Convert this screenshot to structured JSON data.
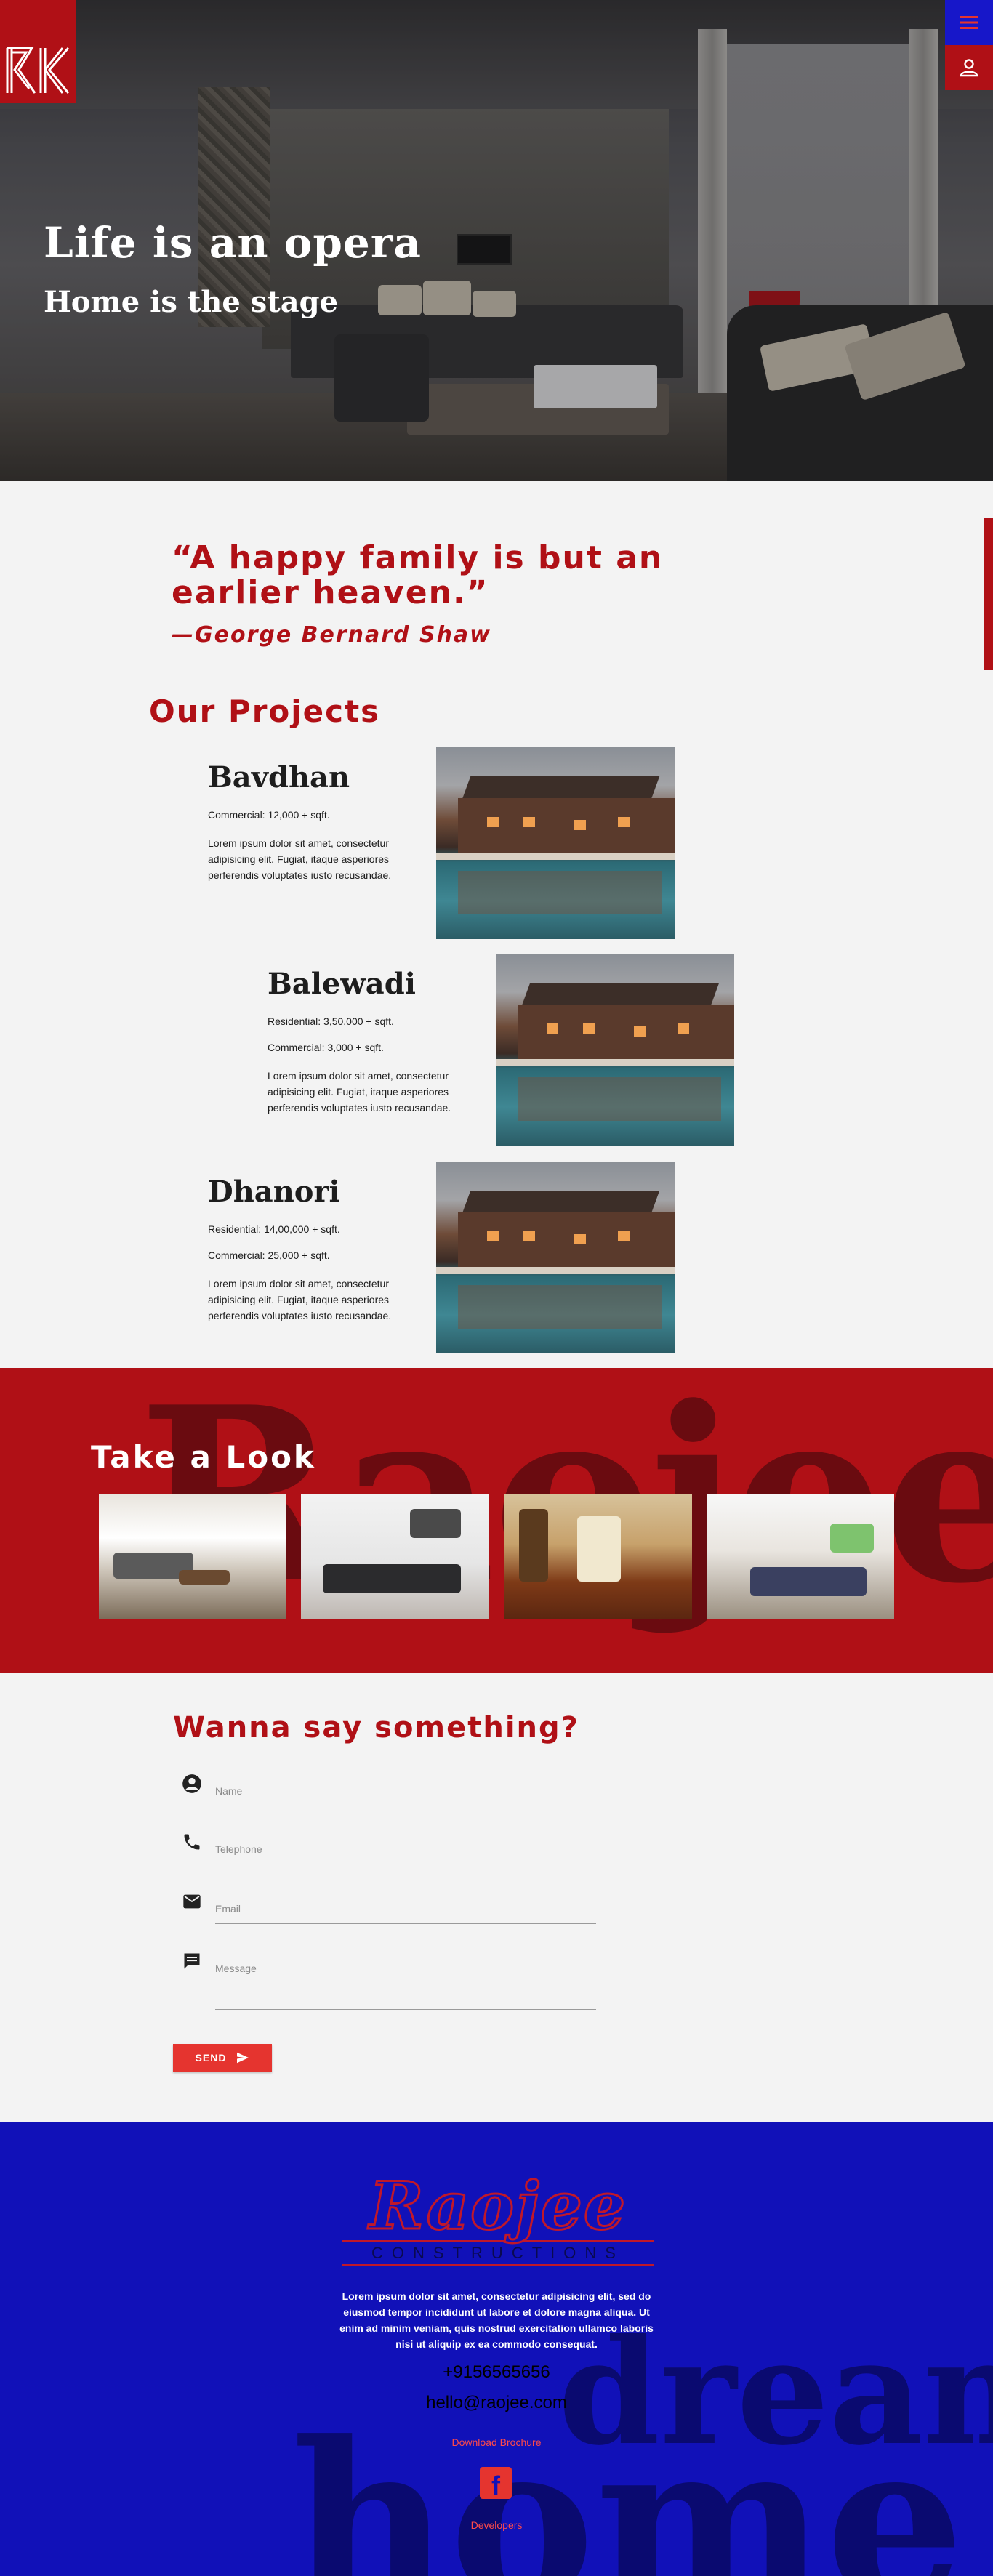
{
  "hero": {
    "title": "Life is an opera",
    "subtitle": "Home is the stage"
  },
  "header": {
    "logo_alt": "RK logo",
    "menu_icon": "hamburger-menu-icon",
    "user_icon": "user-icon"
  },
  "quote": {
    "text": "“A happy family is but an earlier heaven.”",
    "author": "—George Bernard Shaw"
  },
  "projects": {
    "title": "Our Projects",
    "items": [
      {
        "name": "Bavdhan",
        "meta": [
          "Commercial: 12,000 + sqft."
        ],
        "desc": "Lorem ipsum dolor sit amet, consectetur adipisicing elit. Fugiat, itaque asperiores perferendis voluptates iusto recusandae."
      },
      {
        "name": "Balewadi",
        "meta": [
          "Residential: 3,50,000 + sqft.",
          "Commercial: 3,000 + sqft."
        ],
        "desc": "Lorem ipsum dolor sit amet, consectetur adipisicing elit. Fugiat, itaque asperiores perferendis voluptates iusto recusandae."
      },
      {
        "name": "Dhanori",
        "meta": [
          "Residential: 14,00,000 + sqft.",
          "Commercial: 25,000 + sqft."
        ],
        "desc": "Lorem ipsum dolor sit amet, consectetur adipisicing elit. Fugiat, itaque asperiores perferendis voluptates iusto recusandae."
      }
    ]
  },
  "look": {
    "title": "Take a Look",
    "background_word": "Raojee"
  },
  "contact": {
    "title": "Wanna say something?",
    "fields": {
      "name": "Name",
      "telephone": "Telephone",
      "email": "Email",
      "message": "Message"
    },
    "send": "SEND"
  },
  "footer": {
    "brand": "Raojee",
    "brand_sub": "CONSTRUCTIONS",
    "about": "Lorem ipsum dolor sit amet, consectetur adipisicing elit, sed do eiusmod tempor incididunt ut labore et dolore magna aliqua. Ut enim ad minim veniam, quis nostrud exercitation ullamco laboris nisi ut aliquip ex ea commodo consequat.",
    "phone": "+9156565656",
    "email": "hello@raojee.com",
    "brochure": "Download Brochure",
    "developers": "Developers",
    "bg_word_1": "dream",
    "bg_word_2": "home"
  },
  "colors": {
    "red": "#b01016",
    "blue": "#1111b8",
    "accent": "#e5342f"
  }
}
